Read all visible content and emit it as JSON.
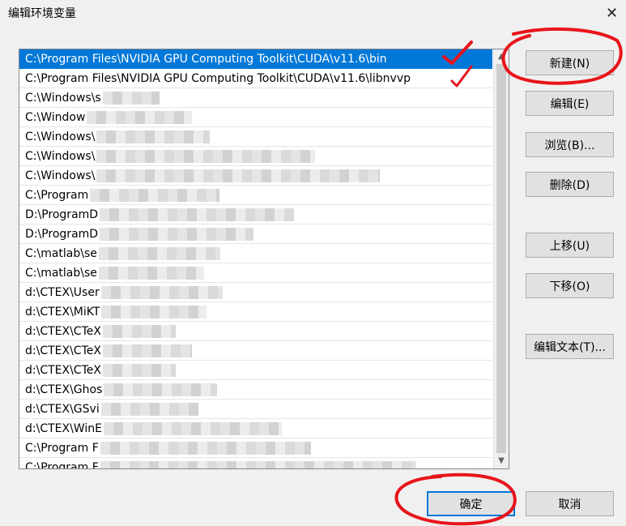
{
  "window": {
    "title": "编辑环境变量",
    "close_label": "✕"
  },
  "list": {
    "items": [
      {
        "text": "C:\\Program Files\\NVIDIA GPU Computing Toolkit\\CUDA\\v11.6\\bin",
        "selected": true
      },
      {
        "text": "C:\\Program Files\\NVIDIA GPU Computing Toolkit\\CUDA\\v11.6\\libnvvp"
      },
      {
        "text": "C:\\Windows\\s"
      },
      {
        "text": "C:\\Window"
      },
      {
        "text": "C:\\Windows\\"
      },
      {
        "text": "C:\\Windows\\"
      },
      {
        "text": "C:\\Windows\\"
      },
      {
        "text": "C:\\Program"
      },
      {
        "text": "D:\\ProgramD"
      },
      {
        "text": "D:\\ProgramD"
      },
      {
        "text": "C:\\matlab\\se"
      },
      {
        "text": "C:\\matlab\\se"
      },
      {
        "text": "d:\\CTEX\\User"
      },
      {
        "text": "d:\\CTEX\\MiKT"
      },
      {
        "text": "d:\\CTEX\\CTeX"
      },
      {
        "text": "d:\\CTEX\\CTeX"
      },
      {
        "text": "d:\\CTEX\\CTeX"
      },
      {
        "text": "d:\\CTEX\\Ghos"
      },
      {
        "text": "d:\\CTEX\\GSvi"
      },
      {
        "text": "d:\\CTEX\\WinE"
      },
      {
        "text": "C:\\Program F"
      },
      {
        "text": "C:\\Program F"
      }
    ]
  },
  "buttons": {
    "new": "新建(N)",
    "edit": "编辑(E)",
    "browse": "浏览(B)...",
    "delete": "删除(D)",
    "move_up": "上移(U)",
    "move_down": "下移(O)",
    "edit_text": "编辑文本(T)...",
    "ok": "确定",
    "cancel": "取消"
  },
  "icons": {
    "scroll_up": "▲",
    "scroll_down": "▼"
  },
  "annotation_color": "#e8141b"
}
